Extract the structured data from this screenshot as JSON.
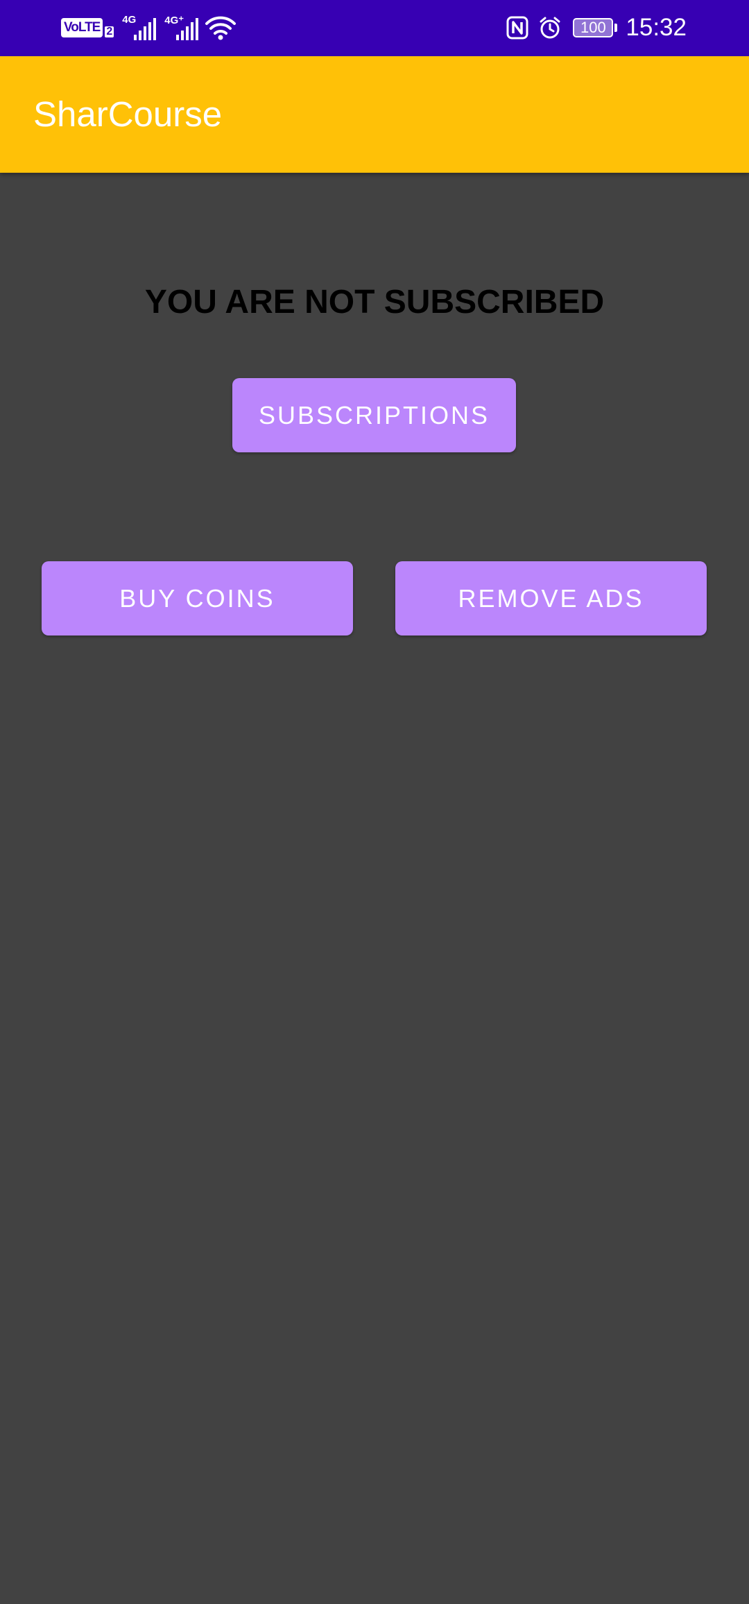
{
  "status_bar": {
    "volte_label": "VoLTE",
    "volte_sub": "2",
    "net1_type": "4G",
    "net2_type": "4G⁺",
    "battery_level": "100",
    "time": "15:32",
    "icons": [
      "volte-icon",
      "signal-icon",
      "signal-icon",
      "wifi-icon",
      "nfc-icon",
      "alarm-icon",
      "battery-icon"
    ]
  },
  "app_bar": {
    "title": "SharCourse",
    "color": "#FFC107"
  },
  "main": {
    "status_heading": "YOU ARE NOT SUBSCRIBED",
    "subscriptions_label": "SUBSCRIPTIONS",
    "buy_coins_label": "BUY COINS",
    "remove_ads_label": "REMOVE ADS"
  },
  "colors": {
    "status_bar": "#3700B3",
    "background": "#424242",
    "button": "#BB86FC",
    "heading": "#000000"
  }
}
